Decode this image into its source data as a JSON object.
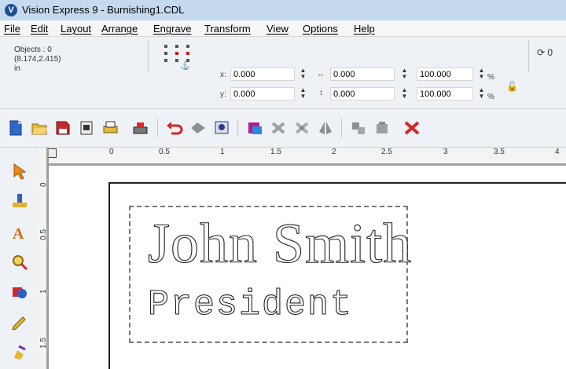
{
  "window": {
    "title": "Vision Express 9 - Burnishing1.CDL",
    "icon_label": "V"
  },
  "menu": [
    {
      "id": "file",
      "label": "File"
    },
    {
      "id": "edit",
      "label": "Edit"
    },
    {
      "id": "layout",
      "label": "Layout"
    },
    {
      "id": "arrange",
      "label": "Arrange"
    },
    {
      "id": "engrave",
      "label": "Engrave"
    },
    {
      "id": "transform",
      "label": "Transform"
    },
    {
      "id": "view",
      "label": "View"
    },
    {
      "id": "options",
      "label": "Options"
    },
    {
      "id": "help",
      "label": "Help"
    }
  ],
  "properties": {
    "objects_label": "Objects : 0",
    "cursor_pos": "(8.174,2.415)",
    "units": "in",
    "x_label": "x:",
    "x_value": "0.000",
    "y_label": "y:",
    "y_value": "0.000",
    "width_value": "0.000",
    "height_value": "0.000",
    "scale_w": "100.000",
    "scale_h": "100.000",
    "percent": "%",
    "rotate_value": "0"
  },
  "ruler": {
    "h_labels": [
      "0",
      "0.5",
      "1",
      "1.5",
      "2",
      "2.5",
      "3",
      "3.5",
      "4"
    ],
    "v_labels": [
      "0",
      "0.5",
      "1",
      "1.5"
    ]
  },
  "canvas": {
    "line1": "John Smith",
    "line2": "President"
  }
}
